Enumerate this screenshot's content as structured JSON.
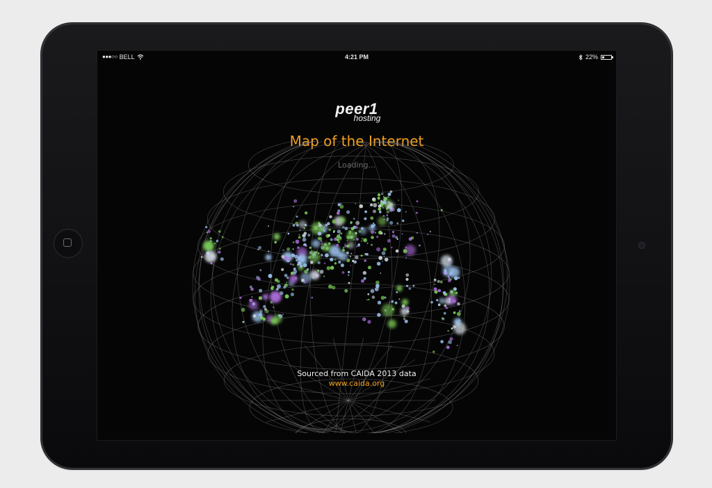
{
  "status": {
    "carrier": "BELL",
    "time": "4:21 PM",
    "battery": "22%",
    "battery_level": 0.22,
    "icons": [
      "signal-dots-icon",
      "wifi-icon",
      "bluetooth-icon",
      "battery-icon"
    ]
  },
  "app": {
    "logo_main": "peer1",
    "logo_sub": "hosting",
    "title": "Map of the Internet",
    "loading": "Loading...",
    "source_text": "Sourced from CAIDA 2013 data",
    "source_link": "www.caida.org"
  },
  "colors": {
    "accent": "#f0a020",
    "background": "#050505",
    "node_blue": "#9fc4f0",
    "node_green": "#7fcf5a",
    "node_purple": "#b070e0",
    "wireframe": "#8a8a8a"
  }
}
